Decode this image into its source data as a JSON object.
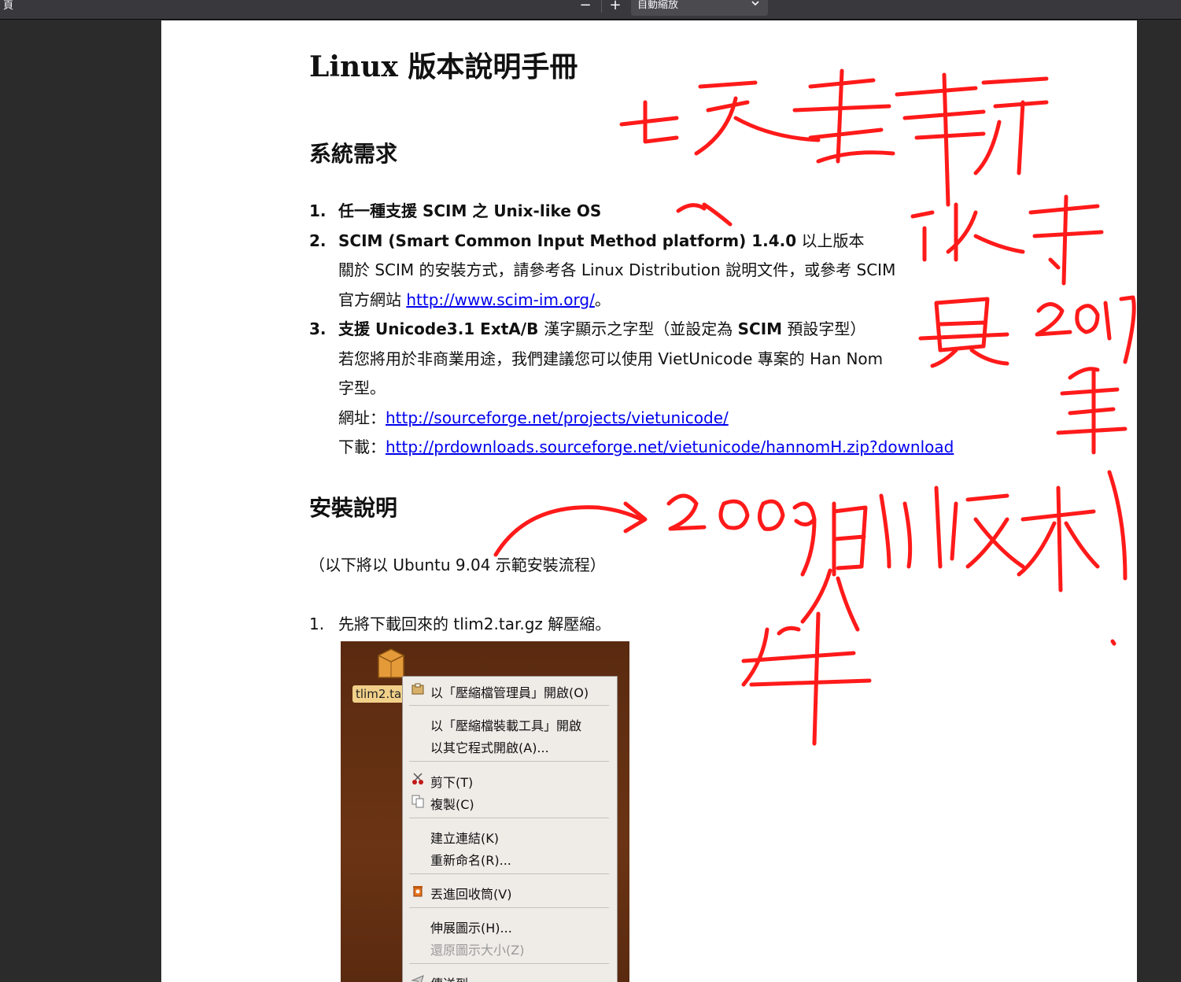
{
  "toolbar": {
    "left_fragment": "頁",
    "zoom_out_symbol": "−",
    "zoom_in_symbol": "+",
    "zoom_value": "自動縮放",
    "dropdown_icon": "chevron-down-icon"
  },
  "document": {
    "title": "Linux  版本說明手冊",
    "section1_heading": "系統需求",
    "req1_num": "1.",
    "req1_text": "任一種支援 SCIM 之 Unix-like OS",
    "req2_num": "2.",
    "req2_text": "SCIM (Smart Common Input Method platform) 1.4.0",
    "req2_suffix": "  以上版本",
    "req2_desc1": "關於 SCIM 的安裝方式，請參考各 Linux Distribution 說明文件，或參考 SCIM",
    "req2_desc2_prefix": "官方網站 ",
    "req2_link": "http://www.scim-im.org/",
    "req2_desc2_suffix": "。",
    "req3_num": "3.",
    "req3_bold1": "支援 Unicode3.1 ExtA/B ",
    "req3_normal1": "漢字顯示之字型（並設定為 ",
    "req3_bold2": "SCIM",
    "req3_normal2": " 預設字型）",
    "req3_desc1": "若您將用於非商業用途，我們建議您可以使用 VietUnicode 專案的 Han Nom",
    "req3_desc2": "字型。",
    "req3_site_label": "網址：",
    "req3_site_link": "http://sourceforge.net/projects/vietunicode/",
    "req3_dl_label": "下載：",
    "req3_dl_link": "http://prdownloads.sourceforge.net/vietunicode/hannomH.zip?download",
    "section2_heading": "安裝說明",
    "install_note": "（以下將以 Ubuntu 9.04 示範安裝流程）",
    "step1_num": "1.",
    "step1_text": "先將下載回來的 tlim2.tar.gz 解壓縮。"
  },
  "screenshot": {
    "file_label": "tlim2.ta",
    "menu_items": [
      {
        "label": "以「壓縮檔管理員」開啟(O)",
        "icon": "archive-icon"
      },
      {
        "label": "以「壓縮檔裝載工具」開啟",
        "icon": ""
      },
      {
        "label": "以其它程式開啟(A)...",
        "icon": ""
      },
      {
        "label": "剪下(T)",
        "icon": "scissors-icon"
      },
      {
        "label": "複製(C)",
        "icon": "copy-icon"
      },
      {
        "label": "建立連結(K)",
        "icon": ""
      },
      {
        "label": "重新命名(R)...",
        "icon": ""
      },
      {
        "label": "丟進回收筒(V)",
        "icon": "trash-icon"
      },
      {
        "label": "伸展圖示(H)...",
        "icon": ""
      },
      {
        "label": "還原圖示大小(Z)",
        "icon": ""
      },
      {
        "label": "傳送到...",
        "icon": "send-icon"
      }
    ]
  },
  "colors": {
    "annotation": "#ff1a1a",
    "link": "#0000ee",
    "toolbar": "#38383d",
    "viewer_bg": "#2b2b2b"
  }
}
